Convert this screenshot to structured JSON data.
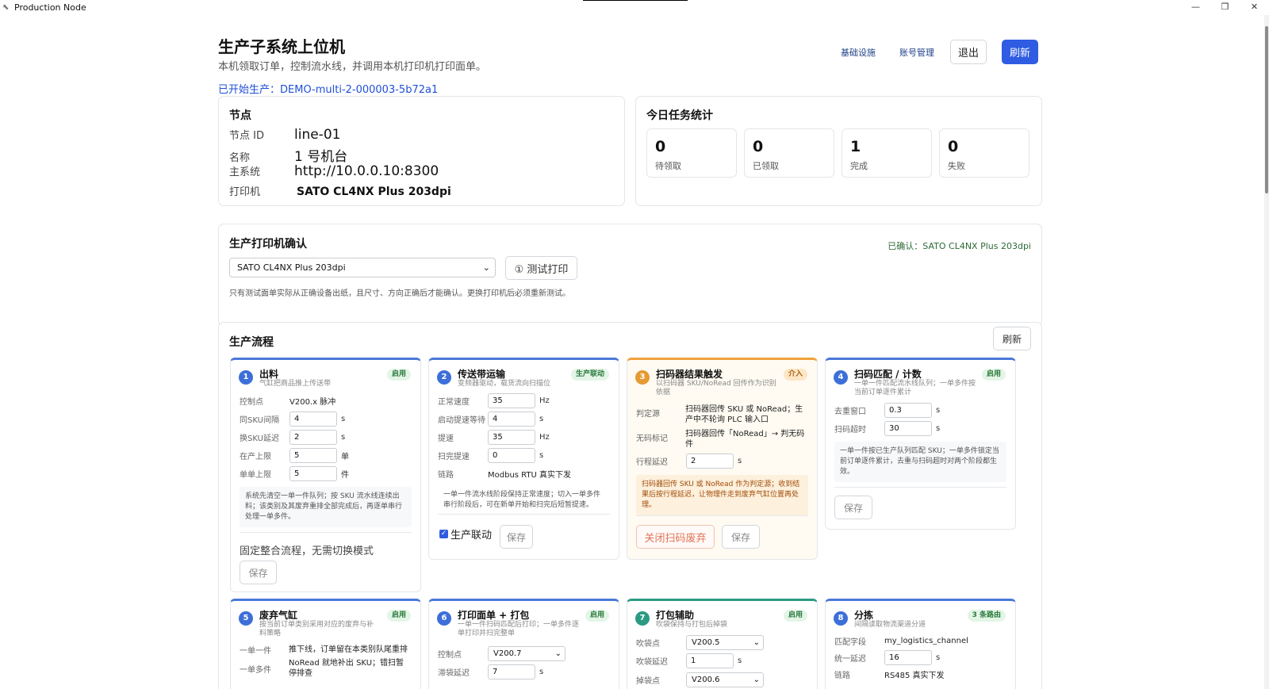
{
  "window": {
    "title": "Production Node",
    "controls": {
      "minimize": "—",
      "restore": "❐",
      "close": "✕"
    }
  },
  "header": {
    "title": "生产子系统上位机",
    "subtitle": "本机领取订单，控制流水线，并调用本机打印机打印面单。",
    "started": "已开始生产：DEMO-multi-2-000003-5b72a1",
    "links": [
      "基础设施",
      "账号管理"
    ],
    "logout": "退出",
    "refresh": "刷新"
  },
  "node": {
    "title": "节点",
    "rows": [
      {
        "k": "节点 ID",
        "v": "line-01"
      },
      {
        "k": "名称",
        "v": "1 号机台"
      },
      {
        "k": "主系统",
        "v": "http://10.0.0.10:8300"
      },
      {
        "k": "打印机",
        "v": "SATO CL4NX Plus 203dpi"
      }
    ]
  },
  "stats": {
    "title": "今日任务统计",
    "items": [
      {
        "num": "0",
        "label": "待领取"
      },
      {
        "num": "0",
        "label": "已领取"
      },
      {
        "num": "1",
        "label": "完成"
      },
      {
        "num": "0",
        "label": "失败"
      }
    ]
  },
  "printer": {
    "title": "生产打印机确认",
    "confirmed": "已确认：SATO CL4NX Plus 203dpi",
    "selected": "SATO CL4NX Plus 203dpi",
    "test_button": "① 测试打印",
    "note": "只有测试面单实际从正确设备出纸，且尺寸、方向正确后才能确认。更换打印机后必须重新测试。"
  },
  "flow": {
    "title": "生产流程",
    "refresh": "刷新",
    "steps": [
      {
        "num": "1",
        "title": "出料",
        "desc": "气缸把商品推上传送带",
        "tag": "启用",
        "fields": [
          {
            "k": "控制点",
            "v": "V200.x 脉冲"
          },
          {
            "k": "同SKU间隔",
            "v": "4",
            "unit": "s"
          },
          {
            "k": "换SKU延迟",
            "v": "2",
            "unit": "s"
          },
          {
            "k": "在产上限",
            "v": "5",
            "unit": "单"
          },
          {
            "k": "单单上限",
            "v": "5",
            "unit": "件"
          }
        ],
        "info": "系统先清空一单一件队列；按 SKU 流水线连续出料；该类别及其废弃重排全部完成后，再逐单串行处理一单多件。",
        "fixed": "固定整合流程，无需切换模式",
        "save": "保存"
      },
      {
        "num": "2",
        "title": "传送带运输",
        "desc": "变频器驱动，载货流向扫描位",
        "tag": "生产联动",
        "fields": [
          {
            "k": "正常速度",
            "v": "35",
            "unit": "Hz"
          },
          {
            "k": "启动提速等待",
            "v": "4",
            "unit": "s"
          },
          {
            "k": "提速",
            "v": "35",
            "unit": "Hz"
          },
          {
            "k": "扫完提速",
            "v": "0",
            "unit": "s"
          },
          {
            "k": "链路",
            "v": "Modbus RTU 真实下发"
          }
        ],
        "info": "一单一件流水线阶段保持正常速度；切入一单多件串行阶段后，可在新单开始和扫完后短暂提速。",
        "checkbox": "生产联动",
        "save": "保存"
      },
      {
        "num": "3",
        "title": "扫码器结果触发",
        "desc": "以扫码器 SKU/NoRead 回传作为识别依据",
        "tag": "介入",
        "fields": [
          {
            "k": "判定源",
            "v": "扫码器回传 SKU 或 NoRead；生产中不轮询 PLC 输入口"
          },
          {
            "k": "无码标记",
            "v": "扫码器回传「NoRead」→ 判无码件"
          },
          {
            "k": "行程延迟",
            "v": "2",
            "unit": "s"
          }
        ],
        "info": "扫码器回传 SKU 或 NoRead 作为判定源；收到结果后按行程延迟，让物理件走到废弃气缸位置再处理。",
        "close_button": "关闭扫码废弃",
        "save": "保存"
      },
      {
        "num": "4",
        "title": "扫码匹配 / 计数",
        "desc": "一单一件匹配流水线队列；一单多件按当前订单逐件累计",
        "tag": "启用",
        "fields": [
          {
            "k": "去重窗口",
            "v": "0.3",
            "unit": "s"
          },
          {
            "k": "扫码超时",
            "v": "30",
            "unit": "s"
          }
        ],
        "info": "一单一件按已生产队列匹配 SKU；一单多件锁定当前订单逐件累计，去重与扫码超时对两个阶段都生效。",
        "save": "保存"
      },
      {
        "num": "5",
        "title": "废弃气缸",
        "desc": "按当前订单类别采用对应的废弃与补料策略",
        "tag": "启用",
        "fields": [
          {
            "k": "一单一件",
            "v": "推下线，订单留在本类别队尾重排"
          },
          {
            "k": "一单多件",
            "v": "NoRead 就地补出 SKU；错扫暂停排查"
          }
        ]
      },
      {
        "num": "6",
        "title": "打印面单 + 打包",
        "desc": "一单一件扫码匹配后打印；一单多件逐单打印并扫完整单",
        "tag": "启用",
        "fields": [
          {
            "k": "控制点",
            "v": "V200.7"
          },
          {
            "k": "滞袋延迟",
            "v": "7",
            "unit": "s"
          }
        ]
      },
      {
        "num": "7",
        "title": "打包辅助",
        "desc": "吹袋保持与打包后掉袋",
        "tag": "启用",
        "fields": [
          {
            "k": "吹袋点",
            "v": "V200.5"
          },
          {
            "k": "吹袋延迟",
            "v": "1",
            "unit": "s"
          },
          {
            "k": "掉袋点",
            "v": "V200.6"
          }
        ]
      },
      {
        "num": "8",
        "title": "分拣",
        "desc": "间隔读取物流渠道分道",
        "tag": "3 条路由",
        "fields": [
          {
            "k": "匹配字段",
            "v": "my_logistics_channel"
          },
          {
            "k": "统一延迟",
            "v": "16",
            "unit": "s"
          },
          {
            "k": "链路",
            "v": "RS485 真实下发"
          }
        ]
      }
    ]
  }
}
